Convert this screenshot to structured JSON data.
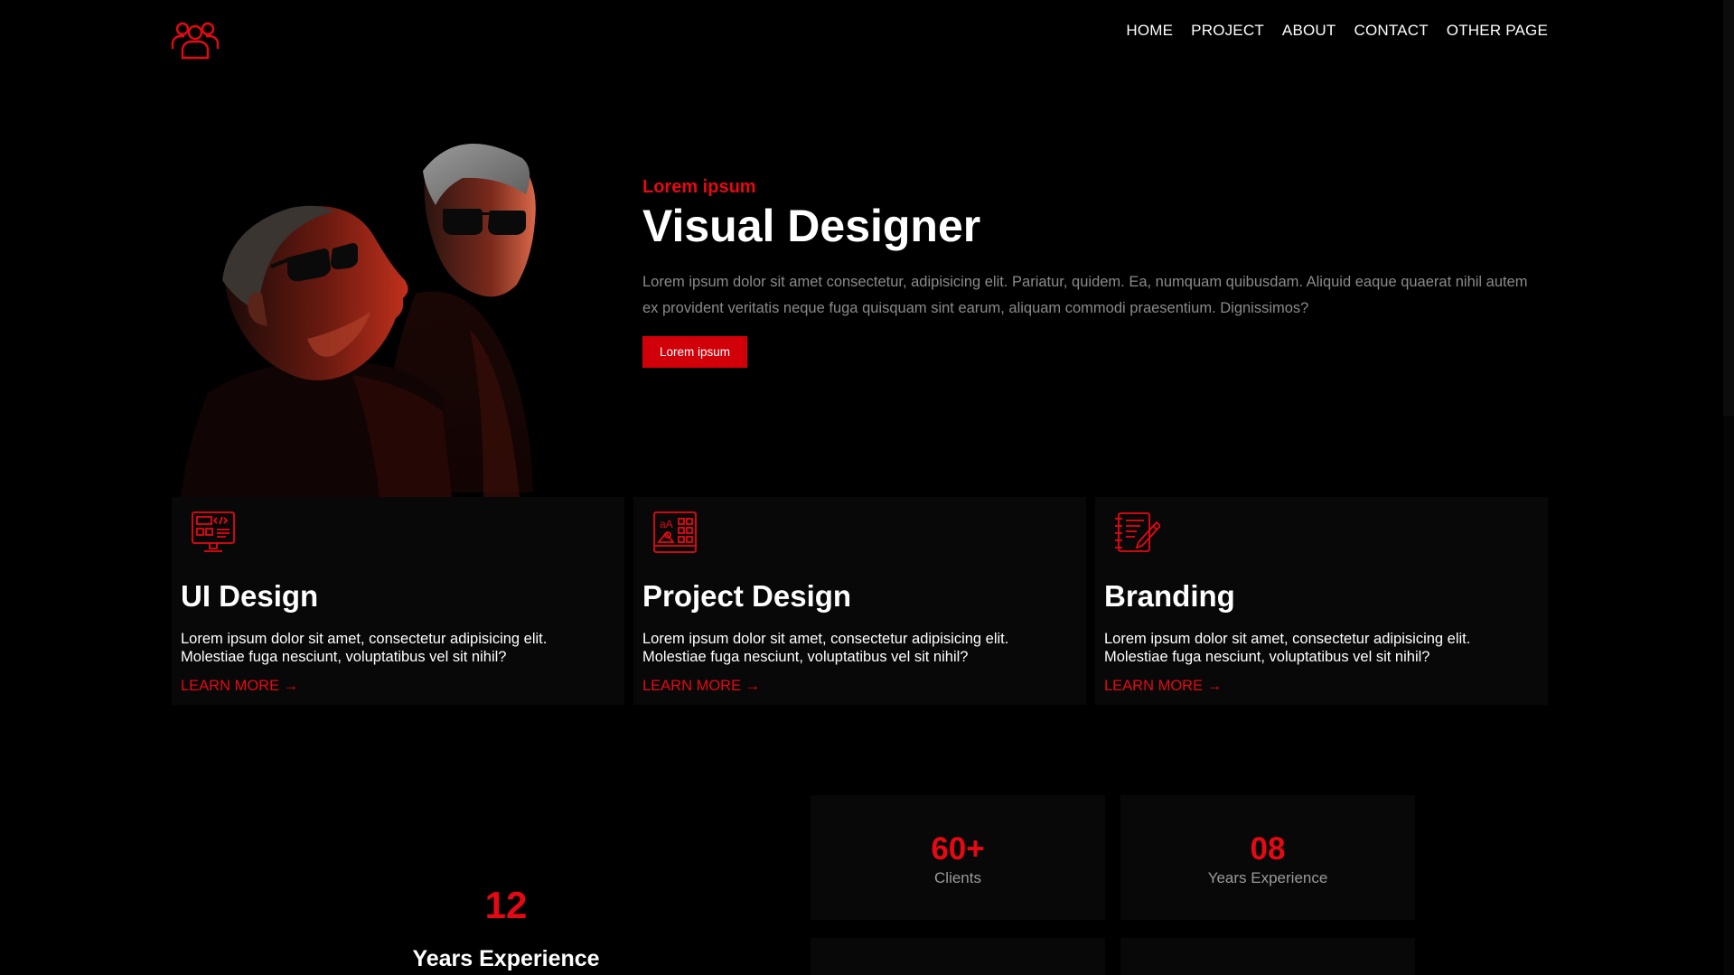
{
  "nav": {
    "items": [
      "HOME",
      "PROJECT",
      "ABOUT",
      "CONTACT",
      "OTHER PAGE"
    ]
  },
  "colors": {
    "accent": "#e50914",
    "background": "#000000",
    "card": "#080808"
  },
  "hero": {
    "eyebrow": "Lorem ipsum",
    "title": "Visual Designer",
    "description": "Lorem ipsum dolor sit amet consectetur, adipisicing elit. Pariatur, quidem. Ea, numquam quibusdam. Aliquid eaque quaerat nihil autem ex provident veritatis neque fuga quisquam sint earum, aliquam commodi praesentium. Dignissimos?",
    "button_label": "Lorem ipsum"
  },
  "services": [
    {
      "icon": "ui-design-icon",
      "title": "UI Design",
      "description_line1": "Lorem ipsum dolor sit amet, consectetur adipisicing elit.",
      "description_line2": "Molestiae fuga nesciunt, voluptatibus vel sit nihil?",
      "link": "LEARN MORE →"
    },
    {
      "icon": "project-design-icon",
      "title": "Project Design",
      "description_line1": "Lorem ipsum dolor sit amet, consectetur adipisicing elit.",
      "description_line2": "Molestiae fuga nesciunt, voluptatibus vel sit nihil?",
      "link": "LEARN MORE →"
    },
    {
      "icon": "branding-icon",
      "title": "Branding",
      "description_line1": "Lorem ipsum dolor sit amet, consectetur adipisicing elit.",
      "description_line2": "Molestiae fuga nesciunt, voluptatibus vel sit nihil?",
      "link": "LEARN MORE →"
    }
  ],
  "stats": {
    "highlight": {
      "number": "12",
      "label": "Years Experience"
    },
    "items": [
      {
        "number": "60+",
        "label": "Clients"
      },
      {
        "number": "08",
        "label": "Years Experience"
      }
    ]
  }
}
